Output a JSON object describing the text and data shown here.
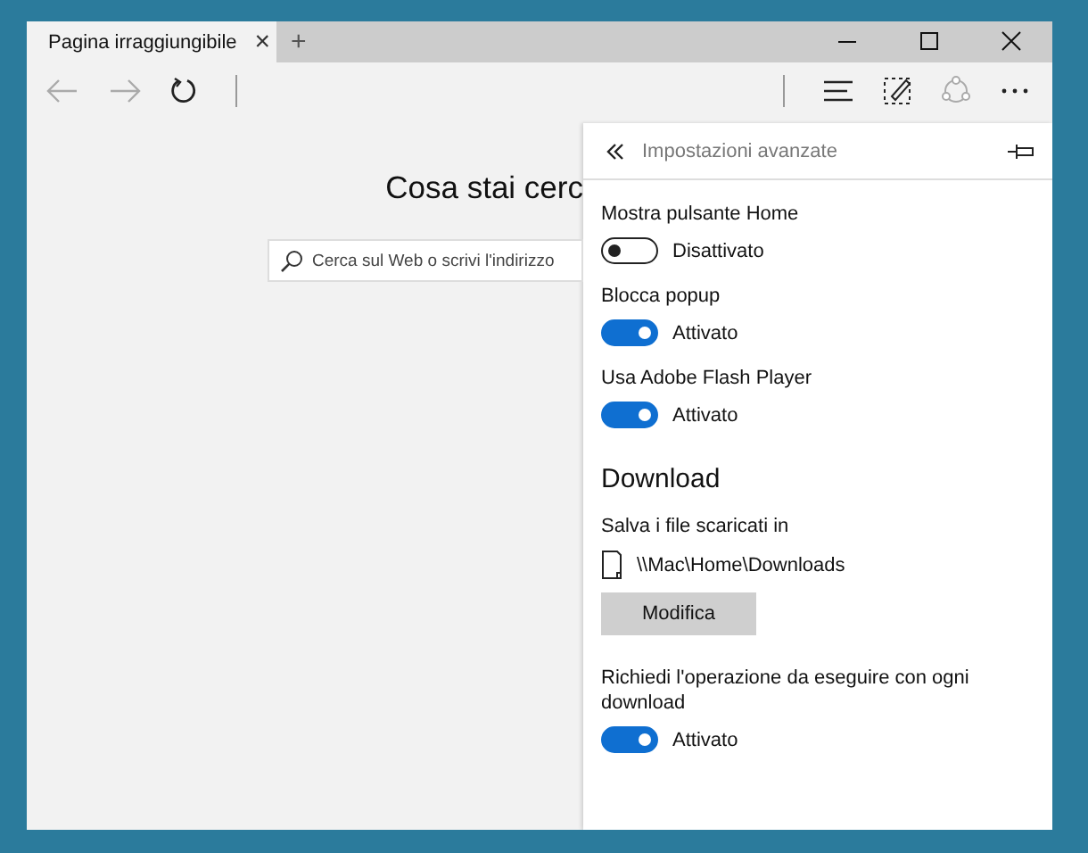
{
  "tab": {
    "title": "Pagina irraggiungibile",
    "close": "×",
    "new": "+"
  },
  "page": {
    "heading": "Cosa stai cerc",
    "search": {
      "placeholder": "Cerca sul Web o scrivi l'indirizzo"
    }
  },
  "panel": {
    "title": "Impostazioni avanzate",
    "items": [
      {
        "kind": "toggle",
        "label": "Mostra pulsante Home",
        "on": false,
        "state": "Disattivato"
      },
      {
        "kind": "toggle",
        "label": "Blocca popup",
        "on": true,
        "state": "Attivato"
      },
      {
        "kind": "toggle",
        "label": "Usa Adobe Flash Player",
        "on": true,
        "state": "Attivato"
      },
      {
        "kind": "heading",
        "label": "Download"
      },
      {
        "kind": "path",
        "label": "Salva i file scaricati in",
        "value": "\\\\Mac\\Home\\Downloads"
      },
      {
        "kind": "button",
        "label": "Modifica"
      },
      {
        "kind": "toggle",
        "label": "Richiedi l'operazione da eseguire con ogni download",
        "on": true,
        "state": "Attivato"
      }
    ]
  }
}
